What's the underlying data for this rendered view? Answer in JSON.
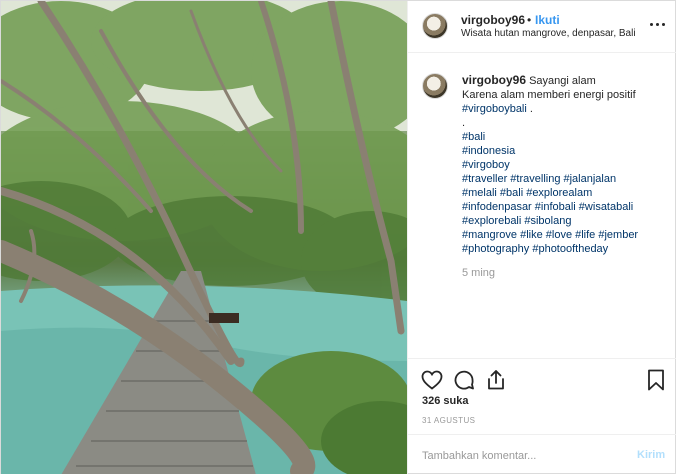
{
  "post": {
    "photo_description_icon": "photo",
    "header": {
      "username": "virgoboy96",
      "separator": "•",
      "follow_label": "Ikuti",
      "location": "Wisata hutan mangrove, denpasar, Bali",
      "more_icon": "more-options-icon"
    },
    "caption": {
      "username": "virgoboy96",
      "text_line1": "Sayangi alam",
      "text_line2": "Karena alam memberi energi positif",
      "tag_line1_tag": "#virgoboybali",
      "tag_line1_suffix": " .",
      "dot1": ".",
      "tags": [
        "#bali",
        "#indonesia",
        "#virgoboy"
      ],
      "tag_rows": [
        "#traveller #travelling #jalanjalan",
        "#melali #bali #explorealam",
        "#infodenpasar #infobali #wisatabali",
        "#explorebali #sibolang",
        "#mangrove #like #love #life #jember",
        "#photography #photooftheday"
      ],
      "time_ago": "5 ming"
    },
    "actions": {
      "like_icon": "heart-icon",
      "comment_icon": "comment-icon",
      "share_icon": "share-icon",
      "save_icon": "bookmark-icon"
    },
    "likes": "326 suka",
    "date": "31 AGUSTUS",
    "comment_box": {
      "placeholder": "Tambahkan komentar...",
      "post_label": "Kirim"
    },
    "colors": {
      "link": "#003569",
      "follow": "#3897f0",
      "post_disabled": "#b2dffc"
    }
  }
}
